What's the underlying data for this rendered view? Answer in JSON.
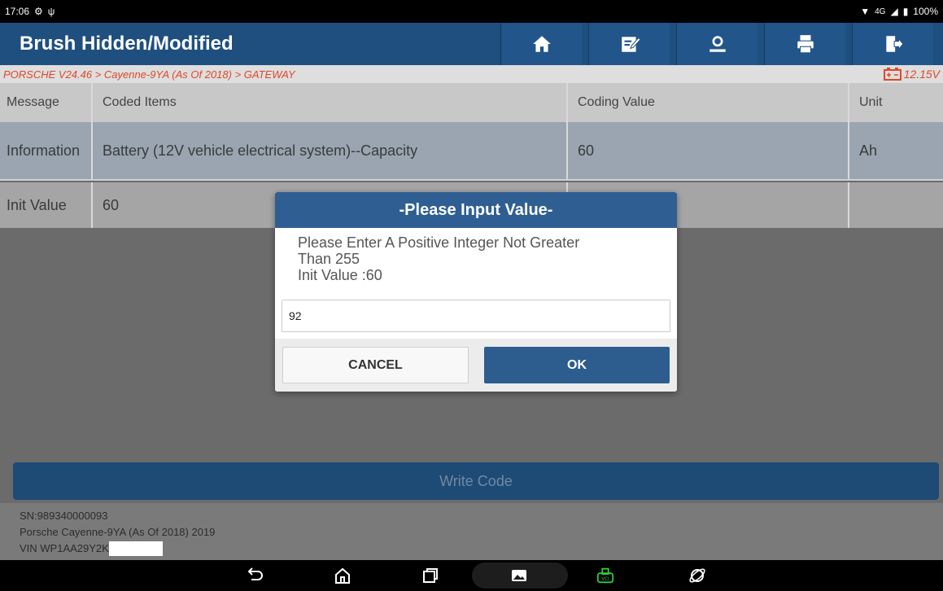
{
  "status_bar": {
    "time": "17:06",
    "network": "4G",
    "battery": "100%"
  },
  "header": {
    "title": "Brush Hidden/Modified",
    "icons": [
      "home-icon",
      "edit-report-icon",
      "user-support-icon",
      "print-icon",
      "exit-icon"
    ]
  },
  "breadcrumb": {
    "path": "PORSCHE V24.46 > Cayenne-9YA (As Of 2018) > GATEWAY",
    "voltage": "12.15V"
  },
  "table": {
    "headers": [
      "Message",
      "Coded Items",
      "Coding Value",
      "Unit"
    ],
    "rows": [
      {
        "message": "Information",
        "item": "Battery (12V vehicle electrical system)--Capacity",
        "value": "60",
        "unit": "Ah"
      },
      {
        "message": "Init Value",
        "item": "60",
        "value": "",
        "unit": ""
      }
    ]
  },
  "write_code_label": "Write Code",
  "footer": {
    "sn": "SN:989340000093",
    "vehicle": "Porsche Cayenne-9YA (As Of 2018) 2019",
    "vin": "VIN WP1AA29Y2K"
  },
  "dialog": {
    "title": "-Please Input Value-",
    "message_line1": "Please Enter A Positive Integer Not Greater",
    "message_line2": "Than 255",
    "message_line3": "Init Value :60",
    "input_value": "92",
    "cancel_label": "CANCEL",
    "ok_label": "OK"
  },
  "colors": {
    "header_bg": "#1f4f7f",
    "accent_red": "#e0472a",
    "dialog_title_bg": "#2f5f92",
    "vci_green": "#2ecc40"
  }
}
